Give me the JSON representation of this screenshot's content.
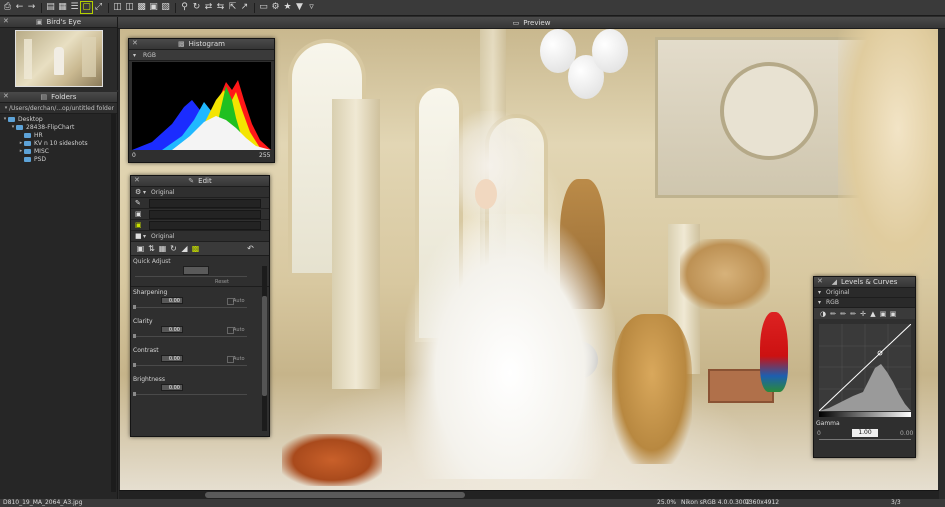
{
  "toolbar": {
    "icons": [
      "print-icon",
      "back-icon",
      "forward-icon",
      "folder-icon",
      "thumbnail-grid-icon",
      "list-view-icon",
      "single-view-icon",
      "fullscreen-icon",
      "compare-icon",
      "split-view-icon",
      "filmstrip-icon",
      "layout-icon",
      "grid-icon",
      "zoom-icon",
      "rotate-icon",
      "crop-icon",
      "transfer-icon",
      "export-icon",
      "monitor-icon",
      "settings-icon",
      "star-icon",
      "filter-icon",
      "funnel-icon"
    ]
  },
  "birds_eye": {
    "title": "Bird's Eye"
  },
  "folders": {
    "title": "Folders",
    "path": "/Users/derchan/...op/untitled folder",
    "items": [
      {
        "label": "Desktop",
        "level": 0
      },
      {
        "label": "28438-FlipChart",
        "level": 1
      },
      {
        "label": "HR",
        "level": 2
      },
      {
        "label": "KV n 10 sideshots",
        "level": 2
      },
      {
        "label": "MISC",
        "level": 2
      },
      {
        "label": "PSD",
        "level": 2
      }
    ]
  },
  "preview": {
    "title": "Preview"
  },
  "histogram": {
    "title": "Histogram",
    "channel": "RGB",
    "min": "0",
    "max": "255"
  },
  "edit": {
    "title": "Edit",
    "preset_top": "Original",
    "preset_bottom": "Original",
    "quick_adjust": {
      "label": "Quick Adjust",
      "reset": "Reset"
    },
    "sliders": [
      {
        "label": "Sharpening",
        "value": "0.00",
        "auto": "Auto"
      },
      {
        "label": "Clarity",
        "value": "0.00",
        "auto": "Auto"
      },
      {
        "label": "Contrast",
        "value": "0.00",
        "auto": "Auto"
      },
      {
        "label": "Brightness",
        "value": "0.00",
        "auto": ""
      }
    ]
  },
  "levels": {
    "title": "Levels & Curves",
    "preset": "Original",
    "channel": "RGB",
    "gamma_label": "Gamma",
    "gamma": "1.00",
    "black": "0",
    "white": "0.00"
  },
  "status": {
    "filename": "D810_19_MA_2064_A3.jpg",
    "zoom": "25.0%",
    "profile": "Nikon sRGB 4.0.0.3002",
    "dimensions": "7360x4912",
    "page": "3/3"
  },
  "colors": {
    "accent": "#b5d000",
    "folder": "#5da3d8"
  }
}
